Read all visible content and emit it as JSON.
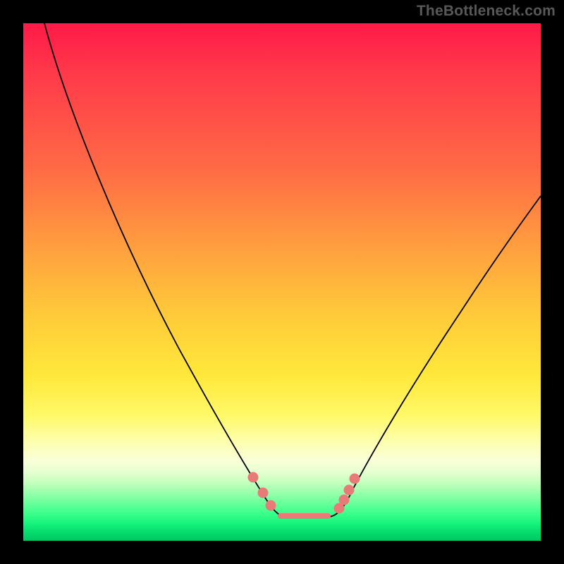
{
  "attribution": "TheBottleneck.com",
  "chart_data": {
    "type": "line",
    "title": "",
    "xlabel": "",
    "ylabel": "",
    "xlim": [
      0,
      100
    ],
    "ylim": [
      0,
      100
    ],
    "series": [
      {
        "name": "bottleneck-curve",
        "x": [
          4,
          10,
          20,
          30,
          38,
          42,
          45,
          47,
          50,
          55,
          60,
          62,
          64,
          70,
          80,
          90,
          100
        ],
        "values": [
          100,
          92,
          76,
          58,
          40,
          28,
          16,
          8,
          5,
          5,
          5,
          8,
          14,
          28,
          45,
          58,
          70
        ]
      }
    ],
    "markers": [
      {
        "name": "dot",
        "x": 44,
        "y": 14
      },
      {
        "name": "dot",
        "x": 46,
        "y": 10
      },
      {
        "name": "dot",
        "x": 47,
        "y": 7
      },
      {
        "name": "dot",
        "x": 61,
        "y": 8
      },
      {
        "name": "dot",
        "x": 62,
        "y": 10
      },
      {
        "name": "dot",
        "x": 63,
        "y": 13
      },
      {
        "name": "dot",
        "x": 64,
        "y": 15
      }
    ],
    "flat_segment": {
      "x0": 49,
      "x1": 59,
      "y": 5
    }
  }
}
